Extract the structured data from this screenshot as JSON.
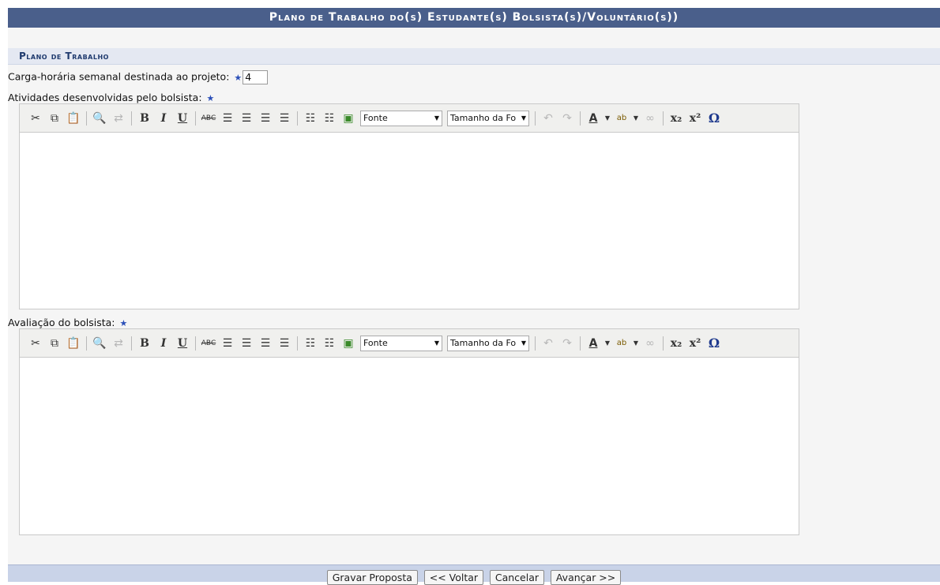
{
  "header": {
    "title": "Plano de Trabalho do(s) Estudante(s) Bolsista(s)/Voluntário(s))"
  },
  "section": {
    "title": "Plano de Trabalho"
  },
  "fields": {
    "hours_label": "Carga-horária semanal destinada ao projeto:",
    "hours_value": "4",
    "activities_label": "Atividades desenvolvidas pelo bolsista:",
    "evaluation_label": "Avaliação do bolsista:",
    "required_mark": "★"
  },
  "toolbar": {
    "font_select": "Fonte",
    "size_select": "Tamanho da Fo",
    "icons": [
      "cut-icon",
      "copy-icon",
      "paste-icon",
      "find-icon",
      "replace-icon",
      "bold-icon",
      "italic-icon",
      "underline-icon",
      "strikethrough-icon",
      "align-left-icon",
      "align-center-icon",
      "align-right-icon",
      "justify-icon",
      "bullet-list-icon",
      "numbered-list-icon",
      "image-icon",
      "undo-icon",
      "redo-icon",
      "text-color-icon",
      "highlight-icon",
      "link-icon",
      "subscript-icon",
      "superscript-icon",
      "special-char-icon"
    ]
  },
  "buttons": {
    "save": "Gravar Proposta",
    "back": "<< Voltar",
    "cancel": "Cancelar",
    "next": "Avançar >>"
  },
  "colors": {
    "header_bg": "#4a5f8b",
    "section_text": "#1f3a6e",
    "required_star": "#2b4fb8",
    "bottom_bar": "#c9d3e8"
  }
}
